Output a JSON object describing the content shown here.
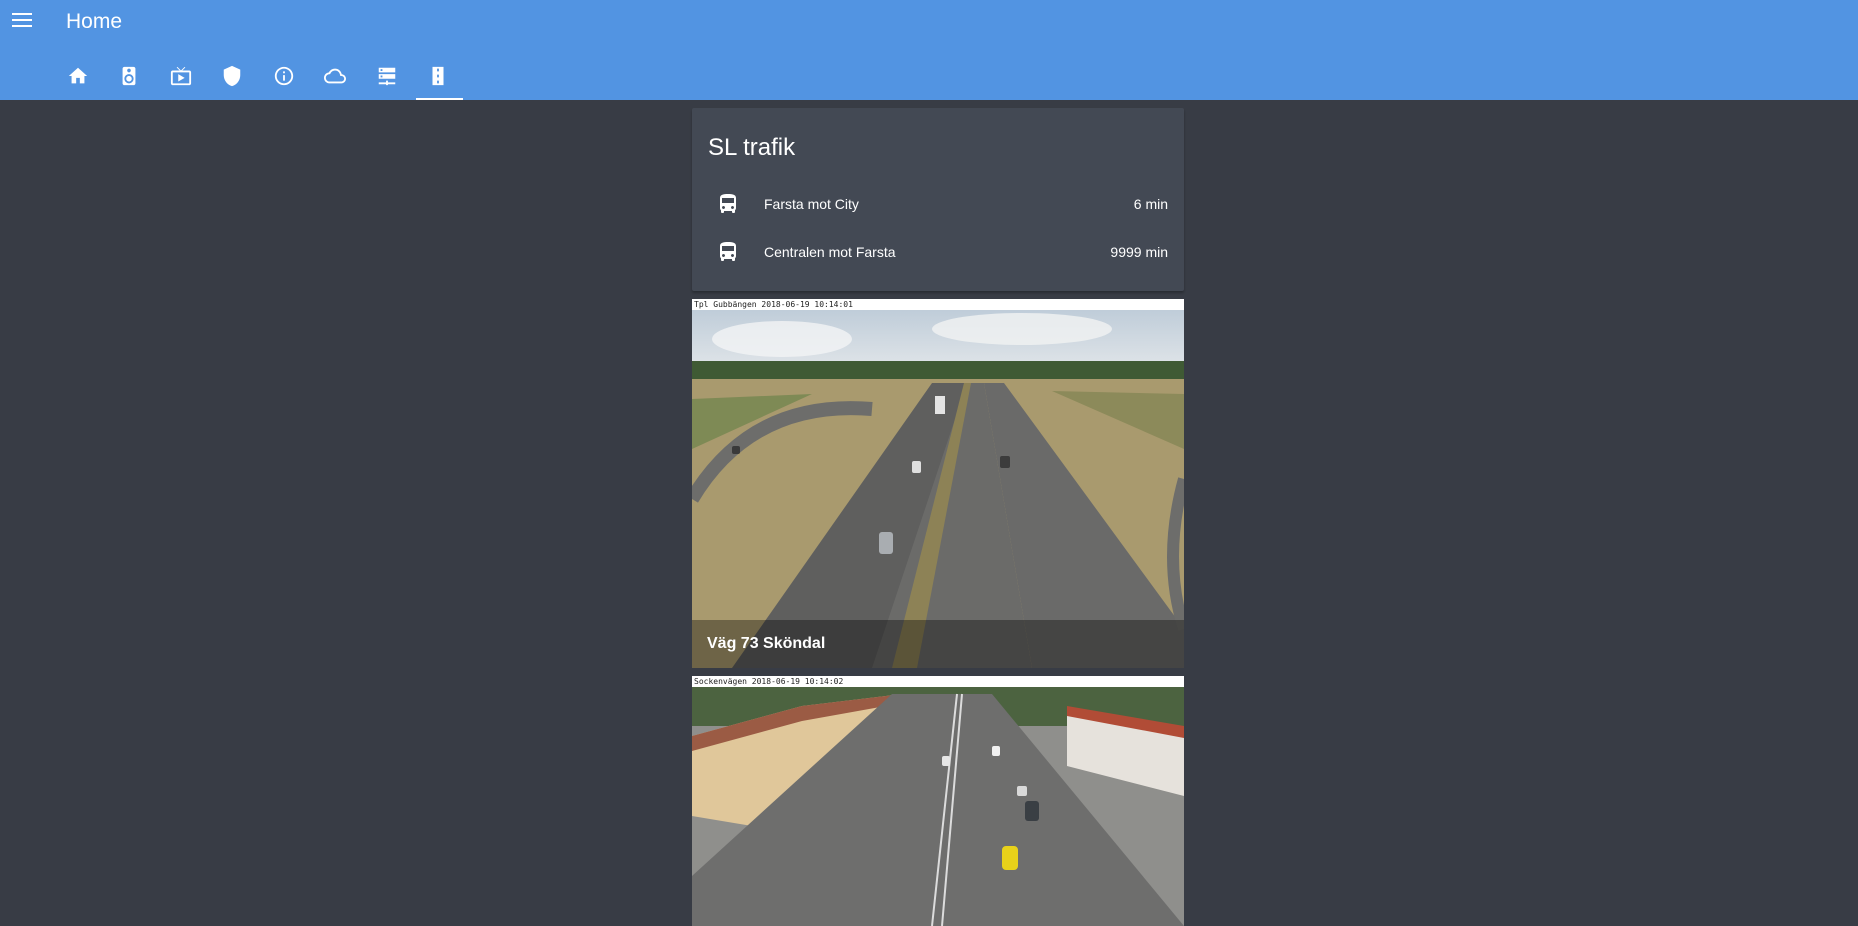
{
  "header": {
    "title": "Home",
    "tabs": [
      {
        "icon": "home-icon"
      },
      {
        "icon": "speaker-icon"
      },
      {
        "icon": "tv-icon"
      },
      {
        "icon": "shield-icon"
      },
      {
        "icon": "info-icon"
      },
      {
        "icon": "cloud-icon"
      },
      {
        "icon": "server-icon"
      },
      {
        "icon": "road-icon",
        "active": true
      }
    ]
  },
  "sl_card": {
    "title": "SL trafik",
    "rows": [
      {
        "icon": "bus-icon",
        "name": "Farsta mot City",
        "value": "6 min"
      },
      {
        "icon": "bus-icon",
        "name": "Centralen mot Farsta",
        "value": "9999 min"
      }
    ]
  },
  "cameras": [
    {
      "stamp": "Tpl Gubbängen 2018-06-19 10:14:01",
      "caption": "Väg 73 Sköndal"
    },
    {
      "stamp": "Sockenvägen 2018-06-19 10:14:02",
      "caption": ""
    }
  ],
  "colors": {
    "header": "#5294e2",
    "background": "#383c45",
    "card": "#434954"
  }
}
